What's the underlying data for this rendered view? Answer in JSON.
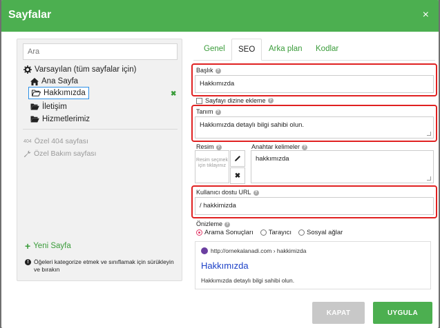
{
  "dialog": {
    "title": "Sayfalar",
    "close_label": "×"
  },
  "sidebar": {
    "search_placeholder": "Ara",
    "root_label": "Varsayılan (tüm sayfalar için)",
    "pages": [
      {
        "label": "Ana Sayfa",
        "icon": "home-icon"
      },
      {
        "label": "Hakkımızda",
        "icon": "folder-open-icon",
        "selected": true,
        "status": "✖"
      },
      {
        "label": "İletişim",
        "icon": "folder-open-icon"
      },
      {
        "label": "Hizmetlerimiz",
        "icon": "folder-open-icon"
      }
    ],
    "special": [
      {
        "prefix": "404",
        "label": "Özel 404 sayfası"
      },
      {
        "label": "Özel Bakım sayfası",
        "icon": "wrench-icon"
      }
    ],
    "new_page_label": "Yeni Sayfa",
    "hint": "Öğeleri kategorize etmek ve sınıflamak için sürükleyin ve bırakın"
  },
  "tabs": [
    "Genel",
    "SEO",
    "Arka plan",
    "Kodlar"
  ],
  "active_tab": "SEO",
  "form": {
    "title_label": "Başlık",
    "title_value": "Hakkımızda",
    "noindex_label": "Sayfayı dizine ekleme",
    "desc_label": "Tanım",
    "desc_value": "Hakkımızda detaylı bilgi sahibi olun.",
    "image_label": "Resim",
    "image_placeholder": "Resim seçmek için tıklayınız",
    "keywords_label": "Anahtar kelimeler",
    "keywords_value": "hakkımızda",
    "url_label": "Kullanıcı dostu URL",
    "url_value": "/ hakkimizda"
  },
  "preview": {
    "label": "Önizleme",
    "options": [
      "Arama Sonuçları",
      "Tarayıcı",
      "Sosyal ağlar"
    ],
    "selected": "Arama Sonuçları",
    "url": "http://ornekalanadi.com › hakkimizda",
    "title": "Hakkımızda",
    "description": "Hakkımızda detaylı bilgi sahibi olun."
  },
  "buttons": {
    "close": "KAPAT",
    "apply": "UYGULA"
  },
  "colors": {
    "accent": "#4caf50",
    "highlight": "#e02020",
    "link": "#1a3fc7"
  }
}
